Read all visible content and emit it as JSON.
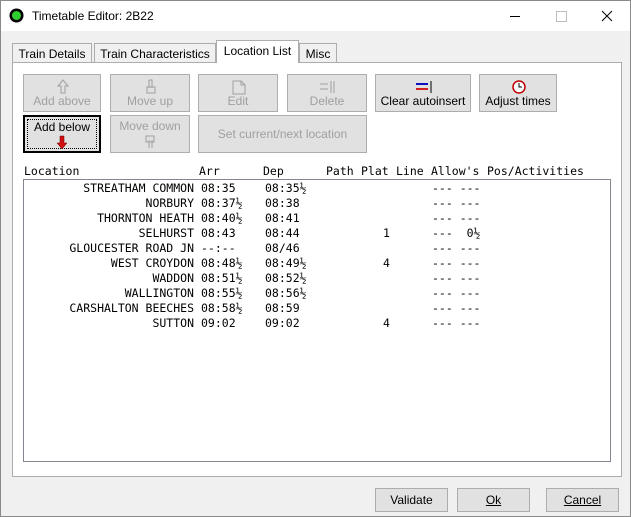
{
  "window": {
    "title": "Timetable Editor: 2B22"
  },
  "tabs": [
    "Train Details",
    "Train Characteristics",
    "Location List",
    "Misc"
  ],
  "toolbar": {
    "add_above": "Add above",
    "move_up": "Move up",
    "edit": "Edit",
    "delete": "Delete",
    "clear_autoinsert": "Clear autoinsert",
    "adjust_times": "Adjust times",
    "add_below": "Add below",
    "move_down": "Move down",
    "set_location": "Set current/next location"
  },
  "list": {
    "headers": [
      "Location",
      "Arr",
      "Dep",
      "Path",
      "Plat",
      "Line",
      "Allow's",
      "Pos/Activities"
    ],
    "rows": [
      {
        "location": "STREATHAM COMMON",
        "arr": "08:35",
        "dep": "08:35½",
        "plat": "",
        "allow": "--- ---"
      },
      {
        "location": "NORBURY",
        "arr": "08:37½",
        "dep": "08:38",
        "plat": "",
        "allow": "--- ---"
      },
      {
        "location": "THORNTON HEATH",
        "arr": "08:40½",
        "dep": "08:41",
        "plat": "",
        "allow": "--- ---"
      },
      {
        "location": "SELHURST",
        "arr": "08:43",
        "dep": "08:44",
        "plat": "1",
        "allow": "---  0½"
      },
      {
        "location": "GLOUCESTER ROAD JN",
        "arr": "--:--",
        "dep": "08/46",
        "plat": "",
        "allow": "--- ---"
      },
      {
        "location": "WEST CROYDON",
        "arr": "08:48½",
        "dep": "08:49½",
        "plat": "4",
        "allow": "--- ---"
      },
      {
        "location": "WADDON",
        "arr": "08:51½",
        "dep": "08:52½",
        "plat": "",
        "allow": "--- ---"
      },
      {
        "location": "WALLINGTON",
        "arr": "08:55½",
        "dep": "08:56½",
        "plat": "",
        "allow": "--- ---"
      },
      {
        "location": "CARSHALTON BEECHES",
        "arr": "08:58½",
        "dep": "08:59",
        "plat": "",
        "allow": "--- ---"
      },
      {
        "location": "SUTTON",
        "arr": "09:02",
        "dep": "09:02",
        "plat": "4",
        "allow": "--- ---"
      }
    ]
  },
  "footer": {
    "validate": "Validate",
    "ok": "Ok",
    "cancel": "Cancel"
  }
}
